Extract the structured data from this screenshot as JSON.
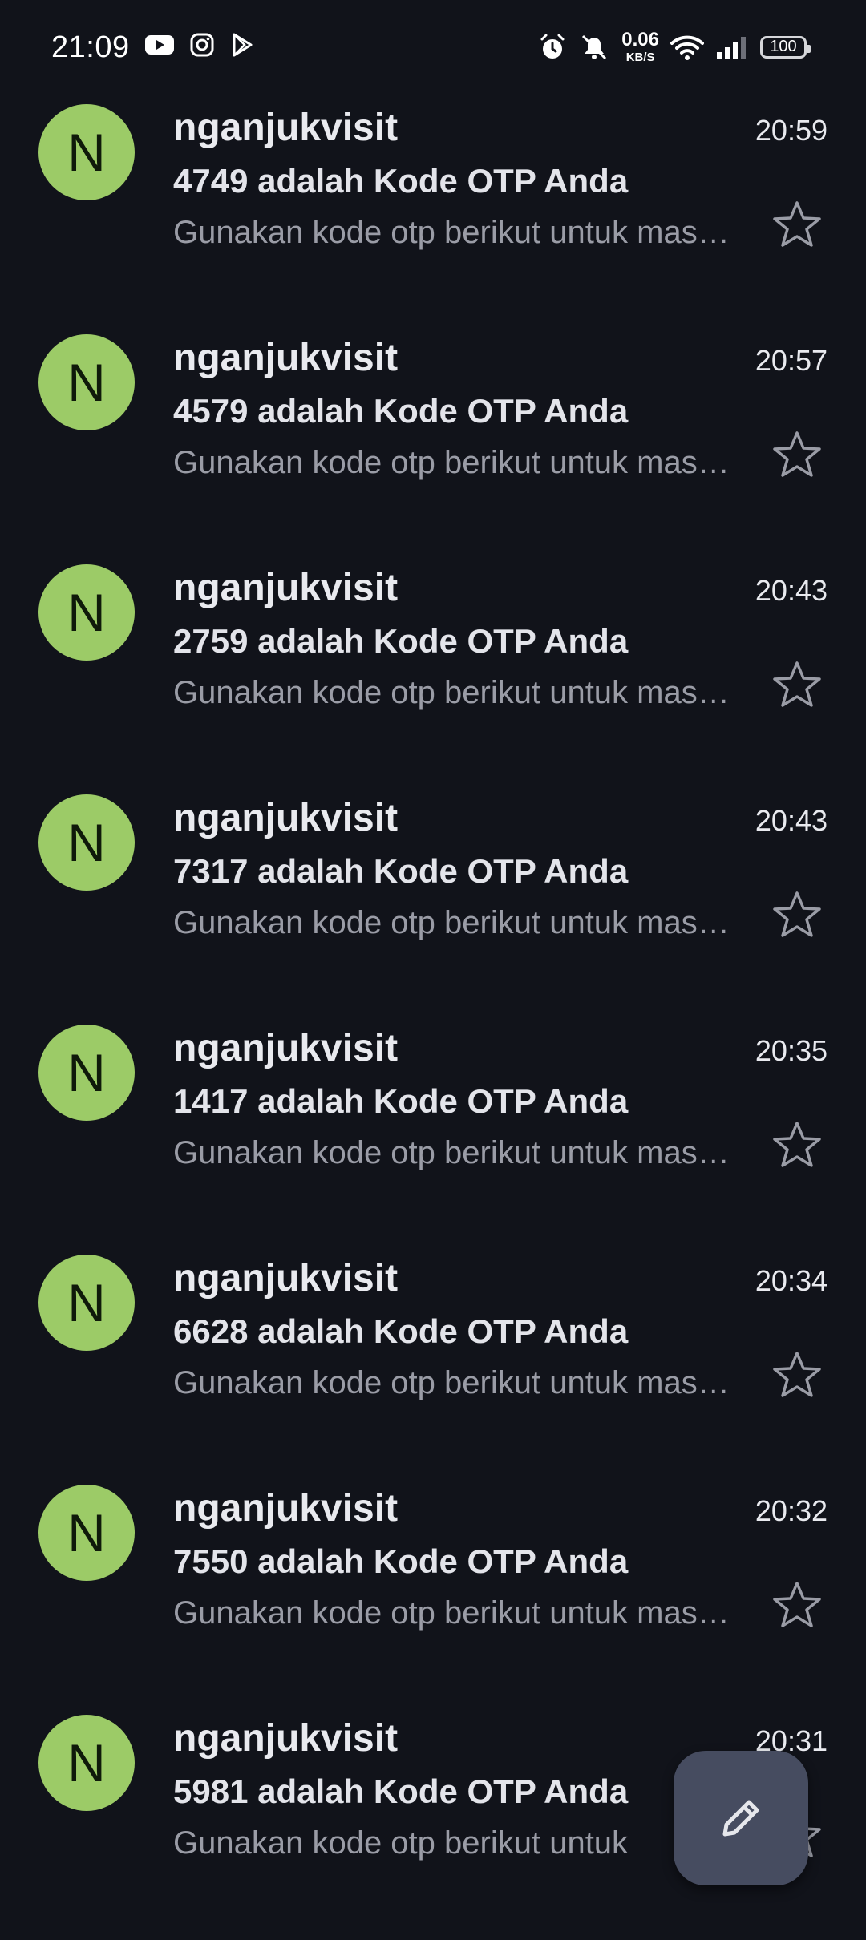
{
  "status_bar": {
    "time": "21:09",
    "net_speed_value": "0.06",
    "net_speed_unit": "KB/S",
    "battery": "100",
    "icons": [
      "youtube-icon",
      "instagram-icon",
      "play-store-icon",
      "alarm-icon",
      "mute-icon",
      "wifi-icon",
      "signal-icon"
    ]
  },
  "emails": [
    {
      "avatar": "N",
      "sender": "nganjukvisit",
      "time": "20:59",
      "subject": "4749 adalah Kode OTP Anda",
      "snippet": "Gunakan kode otp berikut untuk masuk ke akun Anda"
    },
    {
      "avatar": "N",
      "sender": "nganjukvisit",
      "time": "20:57",
      "subject": "4579 adalah Kode OTP Anda",
      "snippet": "Gunakan kode otp berikut untuk masuk ke akun Anda"
    },
    {
      "avatar": "N",
      "sender": "nganjukvisit",
      "time": "20:43",
      "subject": "2759 adalah Kode OTP Anda",
      "snippet": "Gunakan kode otp berikut untuk masuk ke akun Anda"
    },
    {
      "avatar": "N",
      "sender": "nganjukvisit",
      "time": "20:43",
      "subject": "7317 adalah Kode OTP Anda",
      "snippet": "Gunakan kode otp berikut untuk masuk ke akun Anda"
    },
    {
      "avatar": "N",
      "sender": "nganjukvisit",
      "time": "20:35",
      "subject": "1417 adalah Kode OTP Anda",
      "snippet": "Gunakan kode otp berikut untuk masuk ke akun Anda"
    },
    {
      "avatar": "N",
      "sender": "nganjukvisit",
      "time": "20:34",
      "subject": "6628 adalah Kode OTP Anda",
      "snippet": "Gunakan kode otp berikut untuk masuk ke akun Anda"
    },
    {
      "avatar": "N",
      "sender": "nganjukvisit",
      "time": "20:32",
      "subject": "7550 adalah Kode OTP Anda",
      "snippet": "Gunakan kode otp berikut untuk masuk ke akun Anda"
    },
    {
      "avatar": "N",
      "sender": "nganjukvisit",
      "time": "20:31",
      "subject": "5981 adalah Kode OTP Anda",
      "snippet": "Gunakan kode otp berikut untuk"
    }
  ],
  "fab": {
    "icon": "pencil-icon"
  },
  "colors": {
    "background": "#11131a",
    "avatar": "#9ccb67",
    "fab": "#464c60"
  }
}
